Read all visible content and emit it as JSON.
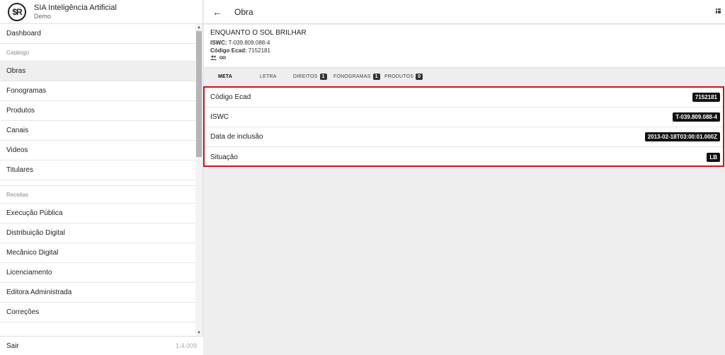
{
  "brand": {
    "logo": "$R",
    "name": "SIA Inteligência Artificial",
    "subtitle": "Demo"
  },
  "sidebar": {
    "items": [
      {
        "type": "item",
        "label": "Dashboard",
        "name": "sidebar-item-dashboard"
      },
      {
        "type": "section",
        "label": "Catálogo",
        "name": "sidebar-section-catalogo"
      },
      {
        "type": "item",
        "label": "Obras",
        "name": "sidebar-item-obras",
        "active": true
      },
      {
        "type": "item",
        "label": "Fonogramas",
        "name": "sidebar-item-fonogramas"
      },
      {
        "type": "item",
        "label": "Produtos",
        "name": "sidebar-item-produtos"
      },
      {
        "type": "item",
        "label": "Canais",
        "name": "sidebar-item-canais"
      },
      {
        "type": "item",
        "label": "Videos",
        "name": "sidebar-item-videos"
      },
      {
        "type": "item",
        "label": "Titulares",
        "name": "sidebar-item-titulares"
      },
      {
        "type": "gap"
      },
      {
        "type": "section",
        "label": "Receitas",
        "name": "sidebar-section-receitas"
      },
      {
        "type": "item",
        "label": "Execução Pública",
        "name": "sidebar-item-execucao-publica"
      },
      {
        "type": "item",
        "label": "Distribuição Digital",
        "name": "sidebar-item-distribuicao-digital"
      },
      {
        "type": "item",
        "label": "Mecânico Digital",
        "name": "sidebar-item-mecanico-digital"
      },
      {
        "type": "item",
        "label": "Licenciamento",
        "name": "sidebar-item-licenciamento"
      },
      {
        "type": "item",
        "label": "Editora Administrada",
        "name": "sidebar-item-editora-administrada"
      },
      {
        "type": "item",
        "label": "Correções",
        "name": "sidebar-item-correcoes"
      }
    ],
    "footer": {
      "logout": "Sair",
      "version": "1.4.009"
    }
  },
  "topbar": {
    "title": "Obra",
    "back_icon": "arrow-left-icon",
    "menu_icon": "grid-icon"
  },
  "work": {
    "title": "ENQUANTO O SOL BRILHAR",
    "iswc_label": "ISWC:",
    "iswc": "T-039.809.088-4",
    "ecad_label": "Código Ecad:",
    "ecad": "7152181",
    "icons": [
      "people-icon",
      "link-icon"
    ]
  },
  "tabs": [
    {
      "label": "META",
      "active": true
    },
    {
      "label": "LETRA"
    },
    {
      "label": "DIREITOS",
      "count": "1"
    },
    {
      "label": "FONOGRAMAS",
      "count": "1"
    },
    {
      "label": "PRODUTOS",
      "count": "0"
    }
  ],
  "details": [
    {
      "label": "Código Ecad",
      "value": "7152181"
    },
    {
      "label": "ISWC",
      "value": "T-039.809.088-4"
    },
    {
      "label": "Data de inclusão",
      "value": "2013-02-18T03:00:01.000Z"
    },
    {
      "label": "Situação",
      "value": "LB"
    }
  ],
  "colors": {
    "highlight_border": "#d0141c",
    "badge_bg": "#111111"
  }
}
